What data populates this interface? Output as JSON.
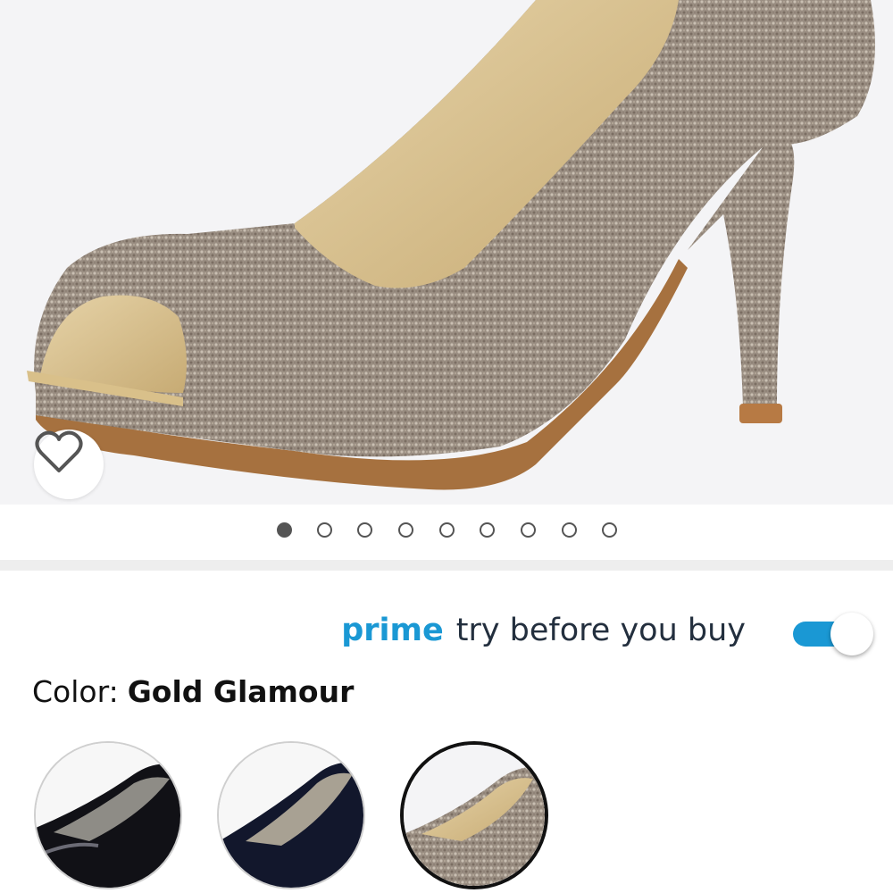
{
  "product": {
    "image_alt": "Gold glitter peep toe high heel pump",
    "wishlist_icon": "heart-outline-icon"
  },
  "carousel": {
    "total_images": 9,
    "active_index": 0
  },
  "prime_try": {
    "brand": "prime",
    "label": "try before you buy",
    "enabled": true,
    "accent": "#1a98d4"
  },
  "color": {
    "label": "Color:",
    "selected_value": "Gold Glamour"
  },
  "swatches": [
    {
      "name": "black-patent",
      "selected": false
    },
    {
      "name": "navy",
      "selected": false
    },
    {
      "name": "gold-glamour",
      "selected": true
    }
  ]
}
